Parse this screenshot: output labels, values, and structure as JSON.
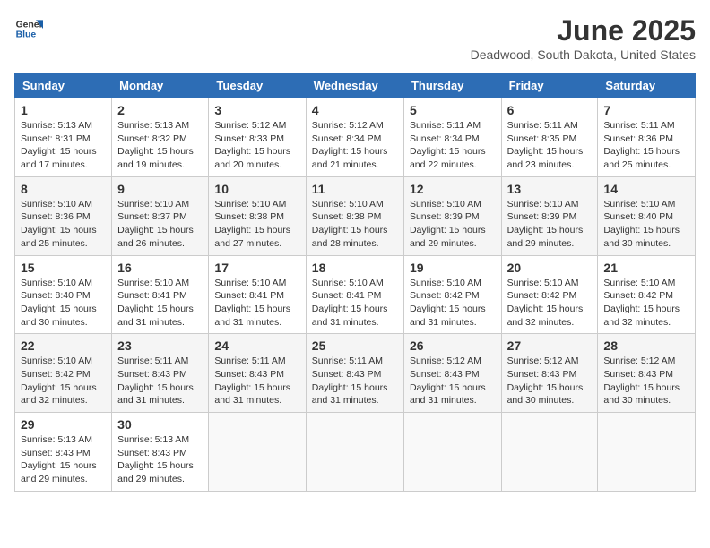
{
  "header": {
    "logo_line1": "General",
    "logo_line2": "Blue",
    "month": "June 2025",
    "location": "Deadwood, South Dakota, United States"
  },
  "weekdays": [
    "Sunday",
    "Monday",
    "Tuesday",
    "Wednesday",
    "Thursday",
    "Friday",
    "Saturday"
  ],
  "weeks": [
    [
      {
        "day": "1",
        "sunrise": "5:13 AM",
        "sunset": "8:31 PM",
        "daylight": "15 hours and 17 minutes."
      },
      {
        "day": "2",
        "sunrise": "5:13 AM",
        "sunset": "8:32 PM",
        "daylight": "15 hours and 19 minutes."
      },
      {
        "day": "3",
        "sunrise": "5:12 AM",
        "sunset": "8:33 PM",
        "daylight": "15 hours and 20 minutes."
      },
      {
        "day": "4",
        "sunrise": "5:12 AM",
        "sunset": "8:34 PM",
        "daylight": "15 hours and 21 minutes."
      },
      {
        "day": "5",
        "sunrise": "5:11 AM",
        "sunset": "8:34 PM",
        "daylight": "15 hours and 22 minutes."
      },
      {
        "day": "6",
        "sunrise": "5:11 AM",
        "sunset": "8:35 PM",
        "daylight": "15 hours and 23 minutes."
      },
      {
        "day": "7",
        "sunrise": "5:11 AM",
        "sunset": "8:36 PM",
        "daylight": "15 hours and 25 minutes."
      }
    ],
    [
      {
        "day": "8",
        "sunrise": "5:10 AM",
        "sunset": "8:36 PM",
        "daylight": "15 hours and 25 minutes."
      },
      {
        "day": "9",
        "sunrise": "5:10 AM",
        "sunset": "8:37 PM",
        "daylight": "15 hours and 26 minutes."
      },
      {
        "day": "10",
        "sunrise": "5:10 AM",
        "sunset": "8:38 PM",
        "daylight": "15 hours and 27 minutes."
      },
      {
        "day": "11",
        "sunrise": "5:10 AM",
        "sunset": "8:38 PM",
        "daylight": "15 hours and 28 minutes."
      },
      {
        "day": "12",
        "sunrise": "5:10 AM",
        "sunset": "8:39 PM",
        "daylight": "15 hours and 29 minutes."
      },
      {
        "day": "13",
        "sunrise": "5:10 AM",
        "sunset": "8:39 PM",
        "daylight": "15 hours and 29 minutes."
      },
      {
        "day": "14",
        "sunrise": "5:10 AM",
        "sunset": "8:40 PM",
        "daylight": "15 hours and 30 minutes."
      }
    ],
    [
      {
        "day": "15",
        "sunrise": "5:10 AM",
        "sunset": "8:40 PM",
        "daylight": "15 hours and 30 minutes."
      },
      {
        "day": "16",
        "sunrise": "5:10 AM",
        "sunset": "8:41 PM",
        "daylight": "15 hours and 31 minutes."
      },
      {
        "day": "17",
        "sunrise": "5:10 AM",
        "sunset": "8:41 PM",
        "daylight": "15 hours and 31 minutes."
      },
      {
        "day": "18",
        "sunrise": "5:10 AM",
        "sunset": "8:41 PM",
        "daylight": "15 hours and 31 minutes."
      },
      {
        "day": "19",
        "sunrise": "5:10 AM",
        "sunset": "8:42 PM",
        "daylight": "15 hours and 31 minutes."
      },
      {
        "day": "20",
        "sunrise": "5:10 AM",
        "sunset": "8:42 PM",
        "daylight": "15 hours and 32 minutes."
      },
      {
        "day": "21",
        "sunrise": "5:10 AM",
        "sunset": "8:42 PM",
        "daylight": "15 hours and 32 minutes."
      }
    ],
    [
      {
        "day": "22",
        "sunrise": "5:10 AM",
        "sunset": "8:42 PM",
        "daylight": "15 hours and 32 minutes."
      },
      {
        "day": "23",
        "sunrise": "5:11 AM",
        "sunset": "8:43 PM",
        "daylight": "15 hours and 31 minutes."
      },
      {
        "day": "24",
        "sunrise": "5:11 AM",
        "sunset": "8:43 PM",
        "daylight": "15 hours and 31 minutes."
      },
      {
        "day": "25",
        "sunrise": "5:11 AM",
        "sunset": "8:43 PM",
        "daylight": "15 hours and 31 minutes."
      },
      {
        "day": "26",
        "sunrise": "5:12 AM",
        "sunset": "8:43 PM",
        "daylight": "15 hours and 31 minutes."
      },
      {
        "day": "27",
        "sunrise": "5:12 AM",
        "sunset": "8:43 PM",
        "daylight": "15 hours and 30 minutes."
      },
      {
        "day": "28",
        "sunrise": "5:12 AM",
        "sunset": "8:43 PM",
        "daylight": "15 hours and 30 minutes."
      }
    ],
    [
      {
        "day": "29",
        "sunrise": "5:13 AM",
        "sunset": "8:43 PM",
        "daylight": "15 hours and 29 minutes."
      },
      {
        "day": "30",
        "sunrise": "5:13 AM",
        "sunset": "8:43 PM",
        "daylight": "15 hours and 29 minutes."
      },
      null,
      null,
      null,
      null,
      null
    ]
  ],
  "labels": {
    "sunrise": "Sunrise:",
    "sunset": "Sunset:",
    "daylight": "Daylight:"
  }
}
